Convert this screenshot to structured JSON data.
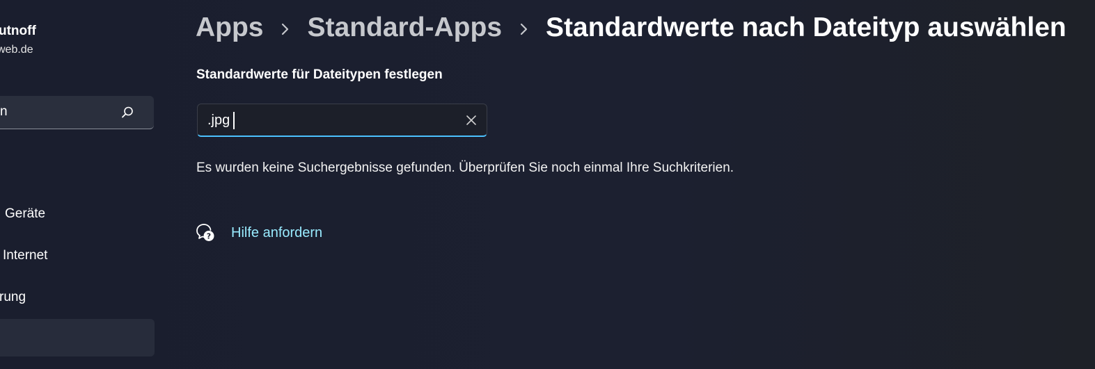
{
  "user": {
    "name": "utnoff",
    "email": "web.de"
  },
  "sidebar": {
    "search_value": "n",
    "items": [
      {
        "label": "Geräte"
      },
      {
        "label": "Internet"
      },
      {
        "label": "rung"
      },
      {
        "label": ""
      }
    ]
  },
  "breadcrumb": {
    "items": [
      "Apps",
      "Standard-Apps"
    ],
    "current": "Standardwerte nach Dateityp auswählen",
    "separator": "›"
  },
  "main": {
    "section_title": "Standardwerte für Dateitypen festlegen",
    "search_value": ".jpg",
    "no_results": "Es wurden keine Suchergebnisse gefunden. Überprüfen Sie noch einmal Ihre Suchkriterien.",
    "help_label": "Hilfe anfordern"
  },
  "icons": {
    "search": "search-icon",
    "clear": "close-icon",
    "help": "help-icon"
  },
  "colors": {
    "accent": "#4cc2ff",
    "link": "#99ebff",
    "background": "#1b1f2c"
  }
}
